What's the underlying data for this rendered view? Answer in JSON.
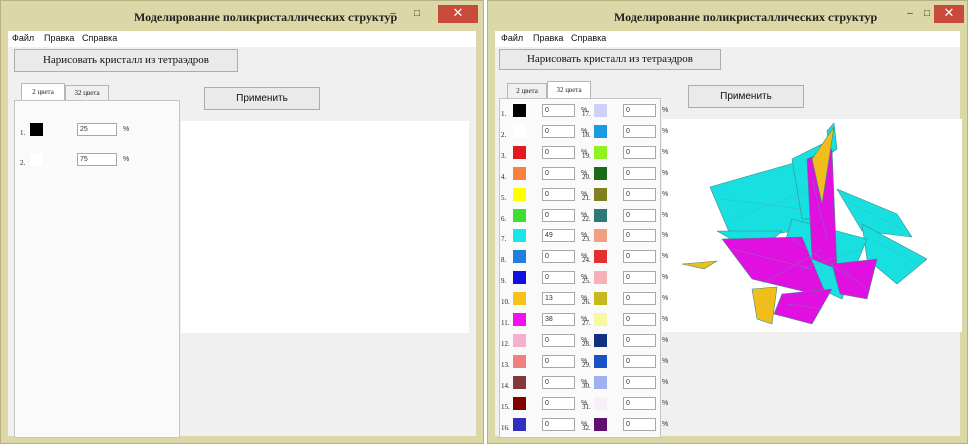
{
  "app": {
    "title": "Моделирование поликристаллических структур"
  },
  "window_controls": {
    "minimize": "–",
    "maximize": "□",
    "close": "✕"
  },
  "menu": {
    "file": "Файл",
    "edit": "Правка",
    "help": "Справка"
  },
  "toolbar": {
    "draw_button": "Нарисовать кристалл из тетраэдров",
    "apply_button": "Применить"
  },
  "tabs": {
    "two_colors": "2 цвета",
    "thirty_two_colors": "32 цвета"
  },
  "percent_unit": "%",
  "left_window": {
    "active_tab": "2 цвета",
    "rows": [
      {
        "num": "1.",
        "color": "#000000",
        "value": "25"
      },
      {
        "num": "2.",
        "color": "#ffffff",
        "value": "75"
      }
    ]
  },
  "right_window": {
    "active_tab": "32 цвета",
    "rows": [
      {
        "num": "1.",
        "color": "#000000",
        "value": "0"
      },
      {
        "num": "2.",
        "color": "#ffffff",
        "value": "0"
      },
      {
        "num": "3.",
        "color": "#e0191e",
        "value": "0"
      },
      {
        "num": "4.",
        "color": "#fa8040",
        "value": "0"
      },
      {
        "num": "5.",
        "color": "#ffff00",
        "value": "0"
      },
      {
        "num": "6.",
        "color": "#3ae02d",
        "value": "0"
      },
      {
        "num": "7.",
        "color": "#19e6e6",
        "value": "49"
      },
      {
        "num": "8.",
        "color": "#2080e0",
        "value": "0"
      },
      {
        "num": "9.",
        "color": "#1010e0",
        "value": "0"
      },
      {
        "num": "10.",
        "color": "#f7c31a",
        "value": "13"
      },
      {
        "num": "11.",
        "color": "#f010f0",
        "value": "38"
      },
      {
        "num": "12.",
        "color": "#f5b0d0",
        "value": "0"
      },
      {
        "num": "13.",
        "color": "#f08080",
        "value": "0"
      },
      {
        "num": "14.",
        "color": "#803838",
        "value": "0"
      },
      {
        "num": "15.",
        "color": "#800000",
        "value": "0"
      },
      {
        "num": "16.",
        "color": "#3030c0",
        "value": "0"
      },
      {
        "num": "17.",
        "color": "#d0d0f8",
        "value": "0"
      },
      {
        "num": "18.",
        "color": "#1a9ae0",
        "value": "0"
      },
      {
        "num": "19.",
        "color": "#90f020",
        "value": "0"
      },
      {
        "num": "20.",
        "color": "#1a6a1a",
        "value": "0"
      },
      {
        "num": "21.",
        "color": "#808020",
        "value": "0"
      },
      {
        "num": "22.",
        "color": "#307878",
        "value": "0"
      },
      {
        "num": "23.",
        "color": "#f0a080",
        "value": "0"
      },
      {
        "num": "24.",
        "color": "#e03030",
        "value": "0"
      },
      {
        "num": "25.",
        "color": "#f5b0b8",
        "value": "0"
      },
      {
        "num": "26.",
        "color": "#c8b820",
        "value": "0"
      },
      {
        "num": "27.",
        "color": "#f8f8a0",
        "value": "0"
      },
      {
        "num": "28.",
        "color": "#103080",
        "value": "0"
      },
      {
        "num": "29.",
        "color": "#1a50c8",
        "value": "0"
      },
      {
        "num": "30.",
        "color": "#a0b0f0",
        "value": "0"
      },
      {
        "num": "31.",
        "color": "#f8f0f8",
        "value": "0"
      },
      {
        "num": "32.",
        "color": "#601070",
        "value": "0"
      }
    ]
  },
  "crystal_colors": {
    "cyan": "#19e0e0",
    "magenta": "#e010e0",
    "gold": "#f0be1a"
  }
}
